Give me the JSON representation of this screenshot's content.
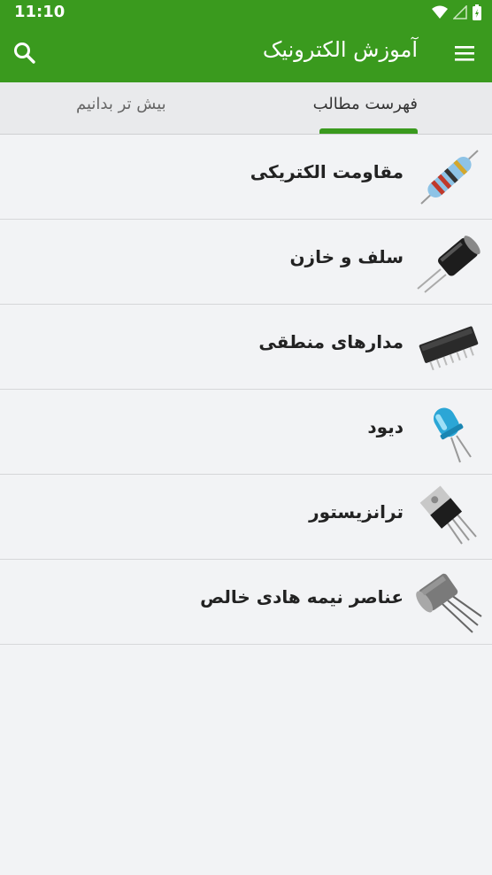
{
  "status": {
    "time": "11:10"
  },
  "appbar": {
    "title": "آموزش الکترونیک"
  },
  "tabs": [
    {
      "label": "فهرست مطالب",
      "selected": true
    },
    {
      "label": "بیش تر بدانیم",
      "selected": false
    }
  ],
  "items": [
    {
      "label": "مقاومت الکتریکی",
      "icon": "resistor-icon"
    },
    {
      "label": "سلف و خازن",
      "icon": "capacitor-icon"
    },
    {
      "label": "مدارهای منطقی",
      "icon": "ic-chip-icon"
    },
    {
      "label": "دیود",
      "icon": "led-diode-icon"
    },
    {
      "label": "ترانزیستور",
      "icon": "transistor-icon"
    },
    {
      "label": "عناصر نیمه هادی خالص",
      "icon": "metal-can-transistor-icon"
    }
  ],
  "colors": {
    "primary": "#3a9a1e",
    "background": "#f2f3f5"
  }
}
